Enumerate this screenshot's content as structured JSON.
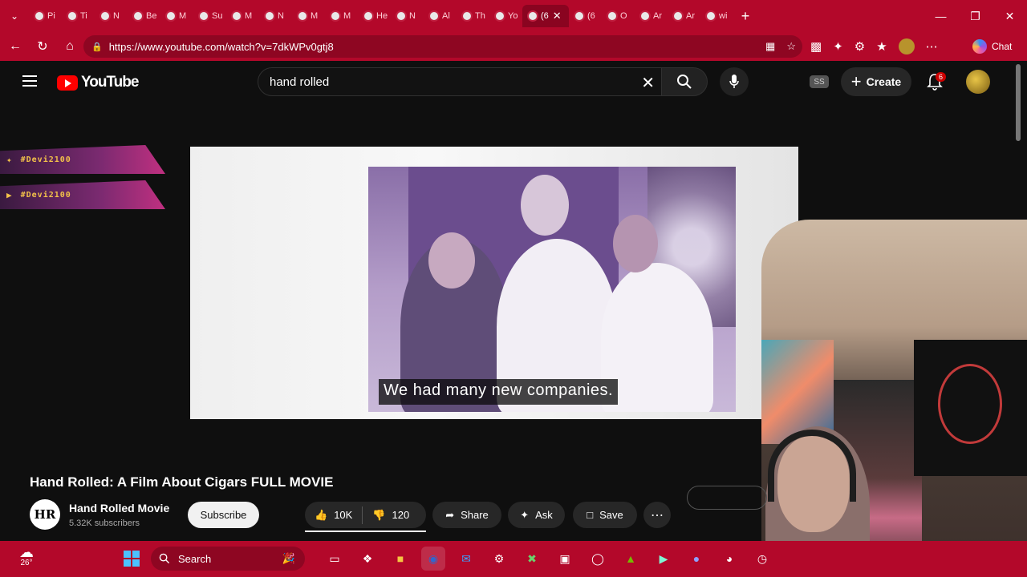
{
  "browser": {
    "tabs": [
      {
        "label": "Pi"
      },
      {
        "label": "Ti"
      },
      {
        "label": "N"
      },
      {
        "label": "Be"
      },
      {
        "label": "M"
      },
      {
        "label": "Su"
      },
      {
        "label": "M"
      },
      {
        "label": "N"
      },
      {
        "label": "M"
      },
      {
        "label": "M"
      },
      {
        "label": "He"
      },
      {
        "label": "N"
      },
      {
        "label": "Al"
      },
      {
        "label": "Th"
      },
      {
        "label": "Yo"
      },
      {
        "label": "(6"
      },
      {
        "label": "(6"
      },
      {
        "label": "O"
      },
      {
        "label": "Ar"
      },
      {
        "label": "Ar"
      },
      {
        "label": "wi"
      }
    ],
    "active_tab_label": "(6",
    "url": "https://www.youtube.com/watch?v=7dkWPv0gtj8",
    "chat_label": "Chat"
  },
  "youtube": {
    "logo_text": "YouTube",
    "search_value": "hand rolled",
    "ss_badge": "SS",
    "create_label": "Create",
    "notification_count": "6"
  },
  "overlay": {
    "handles": [
      "#Devi2100",
      "#Devi2100"
    ]
  },
  "video": {
    "caption": "We had many new companies."
  },
  "details": {
    "title": "Hand Rolled: A Film About Cigars FULL MOVIE",
    "channel_logo": "HR",
    "channel_name": "Hand Rolled Movie",
    "subscribers": "5.32K subscribers",
    "subscribe_label": "Subscribe",
    "likes": "10K",
    "dislikes": "120",
    "share_label": "Share",
    "ask_label": "Ask",
    "save_label": "Save"
  },
  "taskbar": {
    "temperature": "26°",
    "search_label": "Search"
  },
  "colors": {
    "browser_chrome": "#b3082a",
    "yt_background": "#0f0f0f",
    "yt_red": "#ff0000"
  }
}
